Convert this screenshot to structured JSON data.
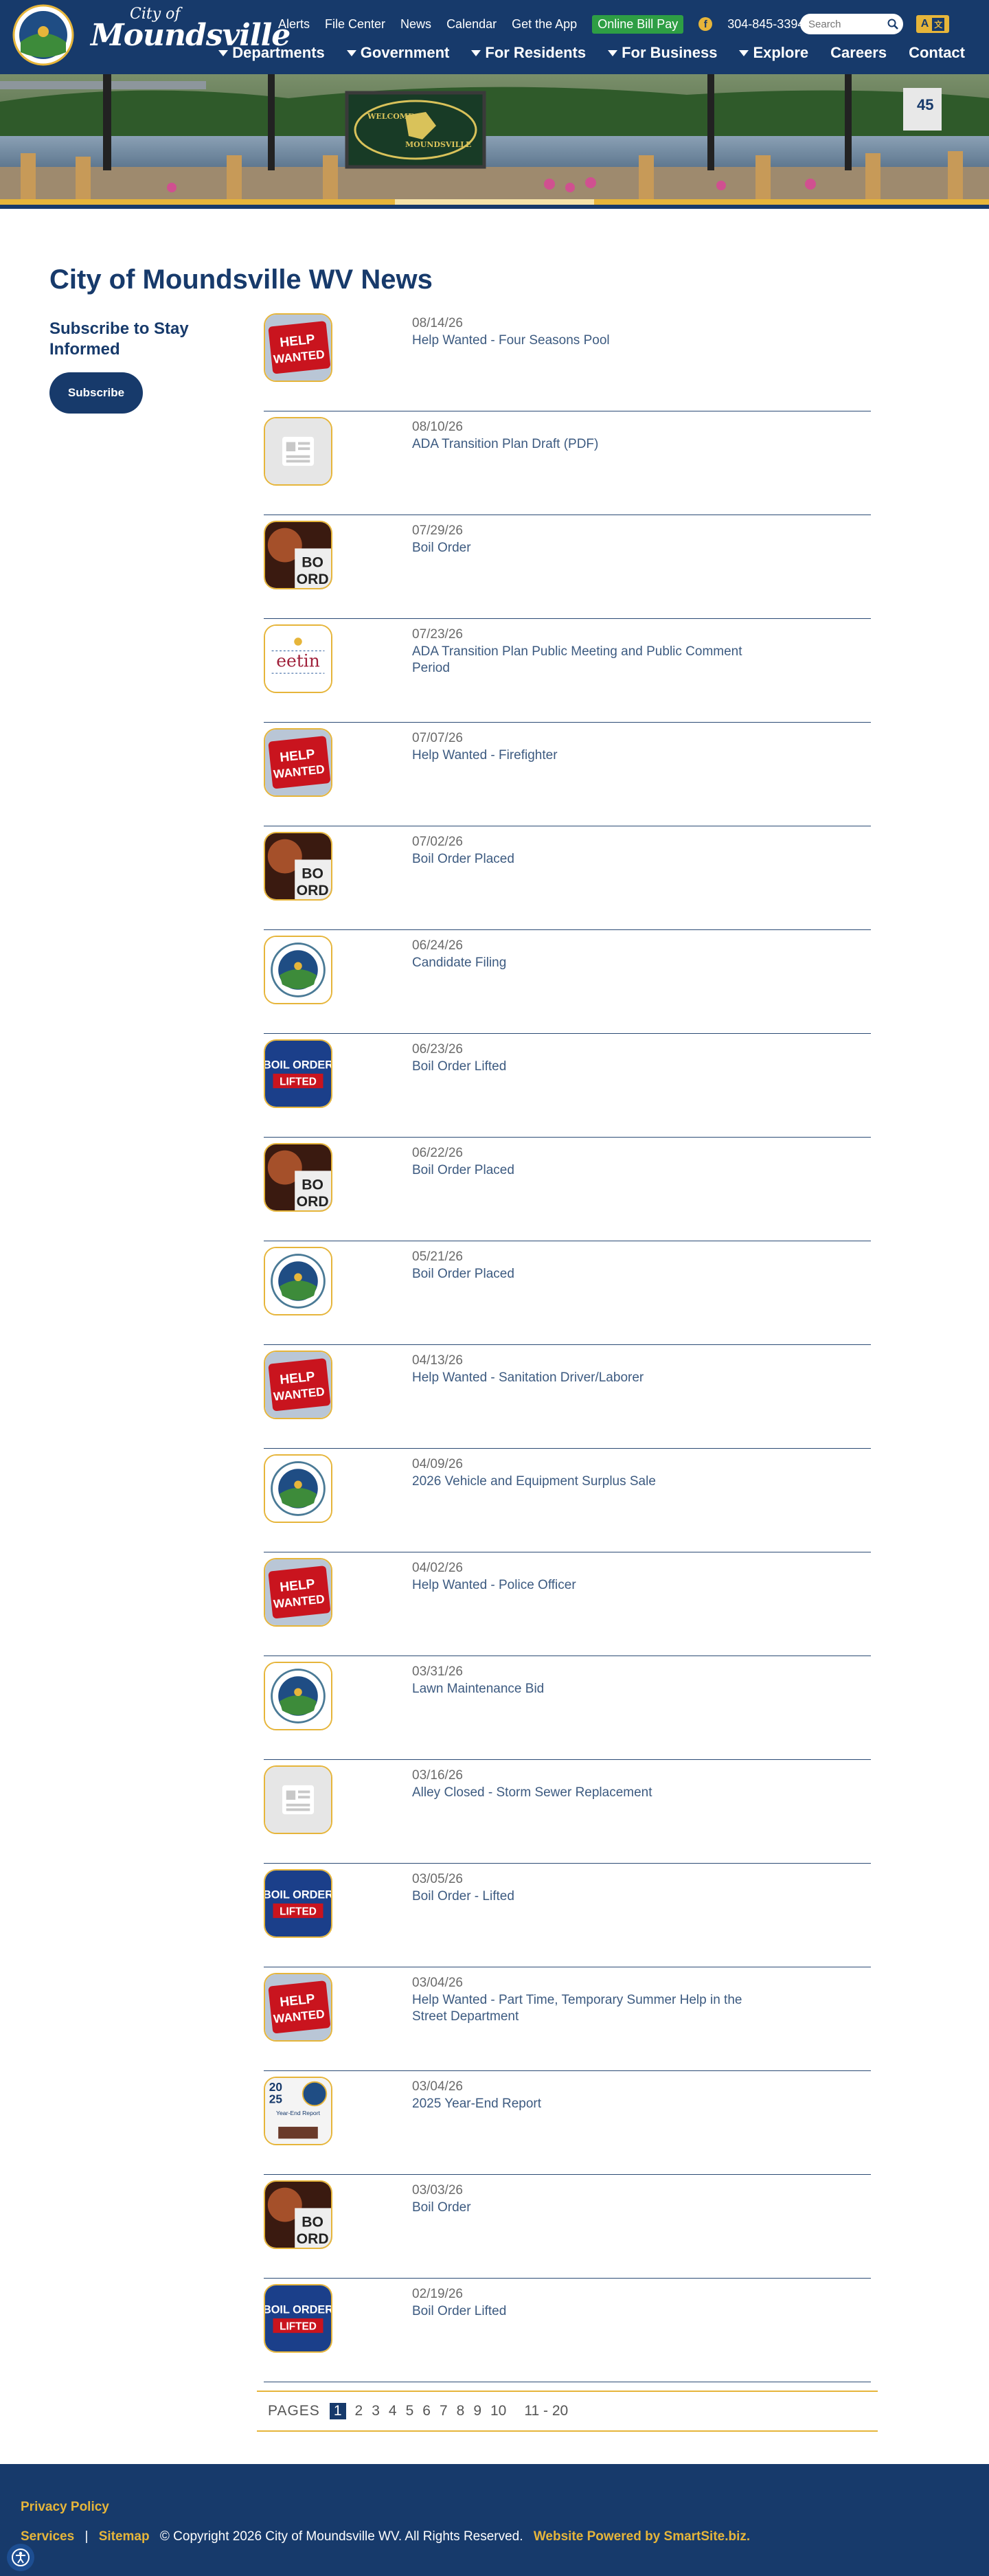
{
  "header": {
    "logo": {
      "city": "City of",
      "name": "Moundsville"
    },
    "utility": [
      "Alerts",
      "File Center",
      "News",
      "Calendar",
      "Get the App"
    ],
    "bill_pay": "Online Bill Pay",
    "facebook": "f",
    "phone": "304-845-3394",
    "search_placeholder": "Search",
    "lang": {
      "a": "A",
      "b": "文"
    },
    "nav": [
      "Departments",
      "Government",
      "For Residents",
      "For Business",
      "Explore",
      "Careers",
      "Contact"
    ]
  },
  "banner": {
    "sign_line1": "WELCOME",
    "sign_line2": "MOUNDSVILLE",
    "river_marker": "45"
  },
  "page": {
    "title": "City of Moundsville WV News"
  },
  "subscribe": {
    "heading": "Subscribe to Stay Informed",
    "button": "Subscribe"
  },
  "news": [
    {
      "date": "08/14/26",
      "title": "Help Wanted - Four Seasons Pool",
      "thumb": "help-wanted"
    },
    {
      "date": "08/10/26",
      "title": "ADA Transition Plan Draft (PDF)",
      "thumb": "placeholder"
    },
    {
      "date": "07/29/26",
      "title": "Boil Order",
      "thumb": "boil-order"
    },
    {
      "date": "07/23/26",
      "title": "ADA Transition Plan Public Meeting and Public Comment Period",
      "thumb": "meeting"
    },
    {
      "date": "07/07/26",
      "title": "Help Wanted - Firefighter",
      "thumb": "help-wanted"
    },
    {
      "date": "07/02/26",
      "title": "Boil Order Placed",
      "thumb": "boil-order"
    },
    {
      "date": "06/24/26",
      "title": "Candidate Filing",
      "thumb": "seal"
    },
    {
      "date": "06/23/26",
      "title": "Boil Order Lifted",
      "thumb": "boil-lifted"
    },
    {
      "date": "06/22/26",
      "title": "Boil Order Placed",
      "thumb": "boil-order"
    },
    {
      "date": "05/21/26",
      "title": "Boil Order Placed",
      "thumb": "seal"
    },
    {
      "date": "04/13/26",
      "title": "Help Wanted - Sanitation Driver/Laborer",
      "thumb": "help-wanted"
    },
    {
      "date": "04/09/26",
      "title": "2026 Vehicle and Equipment Surplus Sale",
      "thumb": "seal"
    },
    {
      "date": "04/02/26",
      "title": "Help Wanted - Police Officer",
      "thumb": "help-wanted"
    },
    {
      "date": "03/31/26",
      "title": "Lawn Maintenance Bid",
      "thumb": "seal"
    },
    {
      "date": "03/16/26",
      "title": "Alley Closed - Storm Sewer Replacement",
      "thumb": "placeholder"
    },
    {
      "date": "03/05/26",
      "title": "Boil Order - Lifted",
      "thumb": "boil-lifted"
    },
    {
      "date": "03/04/26",
      "title": "Help Wanted - Part Time, Temporary Summer Help in the Street Department",
      "thumb": "help-wanted"
    },
    {
      "date": "03/04/26",
      "title": "2025 Year-End Report",
      "thumb": "report"
    },
    {
      "date": "03/03/26",
      "title": "Boil Order",
      "thumb": "boil-order"
    },
    {
      "date": "02/19/26",
      "title": "Boil Order Lifted",
      "thumb": "boil-lifted"
    }
  ],
  "thumb_text": {
    "help_wanted": [
      "HELP",
      "WANTED"
    ],
    "boil": [
      "BO",
      "ORD"
    ],
    "boil_lifted": [
      "BOIL ORDER",
      "LIFTED"
    ],
    "meeting": "eetin",
    "report": [
      "20",
      "25",
      "Year-End Report"
    ]
  },
  "pager": {
    "label": "PAGES",
    "current": "1",
    "pages": [
      "2",
      "3",
      "4",
      "5",
      "6",
      "7",
      "8",
      "9",
      "10"
    ],
    "next_range": "11 - 20"
  },
  "footer": {
    "privacy": "Privacy Policy",
    "services": "Services",
    "sep": "|",
    "sitemap": "Sitemap",
    "copyright": "© Copyright 2026 City of Moundsville WV.  All Rights Reserved.",
    "powered": "Website Powered by SmartSite.biz."
  },
  "colors": {
    "navy": "#173a6b",
    "gold": "#e6b53a",
    "green": "#2e9e44"
  }
}
